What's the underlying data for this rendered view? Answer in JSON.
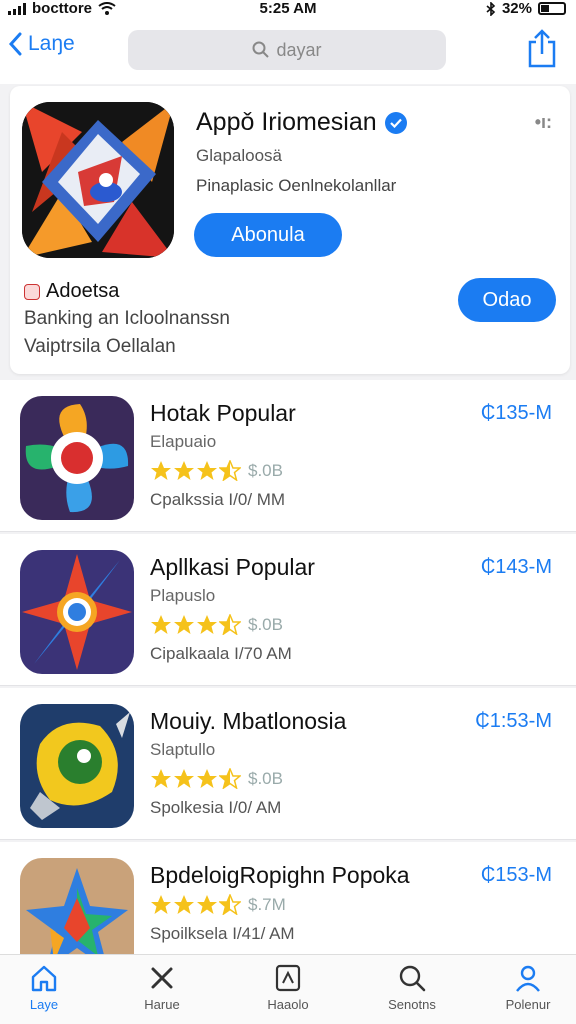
{
  "status_bar": {
    "carrier": "bocttore",
    "time": "5:25 AM",
    "battery": "32%"
  },
  "nav": {
    "back_label": "Laŋe",
    "search_placeholder": "dayar"
  },
  "featured": {
    "title": "Appǒ Iriomesian",
    "subtitle": "Glapaloosä",
    "description": "Pinaplasic Oenlnekolanllar",
    "more": "•ı:",
    "button_label": "Abonula",
    "ad_label": "Adoetsa",
    "ad_desc_1": "Banking an Icloolnanssn",
    "ad_desc_2": "Vaiptrsila Oellalan",
    "ad_button_label": "Odao"
  },
  "apps": [
    {
      "title": "Hotak Popular",
      "category": "Elapuaio",
      "rating": "$.0B",
      "meta": "Cpalkssia  I/0/ MM",
      "price": "₵135-M",
      "stars": 3.5
    },
    {
      "title": "Apllkasi Popular",
      "category": "Plapuslo",
      "rating": "$.0B",
      "meta": "Cipalkaala  I/70 AM",
      "price": "₵143-M",
      "stars": 3.5
    },
    {
      "title": "Mouiy. Mbatlonosia",
      "category": "Slaptullo",
      "rating": "$.0B",
      "meta": "Spolkesia  I/0/ AM",
      "price": "₵1:53-M",
      "stars": 3.5
    },
    {
      "title": "BpdeloigRopighn Popoka",
      "category": "",
      "rating": "$.7M",
      "meta": "Spoilksela  I/41/ AM",
      "price": "₵153-M",
      "stars": 3.5
    }
  ],
  "tabs": [
    {
      "label": "Laye",
      "icon": "home-icon",
      "active": true
    },
    {
      "label": "Harue",
      "icon": "close-icon",
      "active": false
    },
    {
      "label": "Haaolo",
      "icon": "document-icon",
      "active": false
    },
    {
      "label": "Senotns",
      "icon": "search-icon",
      "active": false
    },
    {
      "label": "Polenur",
      "icon": "person-icon",
      "active": false
    }
  ],
  "colors": {
    "accent": "#1b7cf2",
    "star": "#f5c21b"
  }
}
